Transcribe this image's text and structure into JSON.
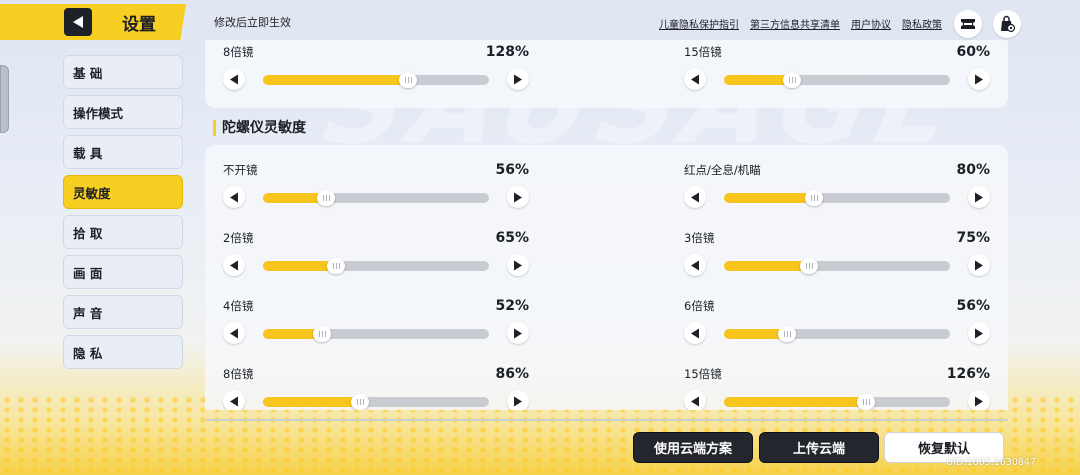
{
  "header": {
    "title": "设置",
    "note": "修改后立即生效"
  },
  "top_links": [
    "儿童隐私保护指引",
    "第三方信息共享清单",
    "用户协议",
    "隐私政策"
  ],
  "icons": {
    "back": "back-arrow-icon",
    "top_1": "ticket-icon",
    "top_2": "bag-settings-icon"
  },
  "sidebar": {
    "items": [
      {
        "label": "基 础",
        "active": false
      },
      {
        "label": "操作模式",
        "active": false
      },
      {
        "label": "载 具",
        "active": false
      },
      {
        "label": "灵敏度",
        "active": true
      },
      {
        "label": "拾 取",
        "active": false
      },
      {
        "label": "画 面",
        "active": false
      },
      {
        "label": "声 音",
        "active": false
      },
      {
        "label": "隐 私",
        "active": false
      }
    ]
  },
  "top_card": {
    "rows": [
      {
        "label": "8倍镜",
        "value": 128,
        "percent": "128%"
      },
      {
        "label": "15倍镜",
        "value": 60,
        "percent": "60%"
      }
    ]
  },
  "gyro": {
    "title": "陀螺仪灵敏度",
    "rows": [
      {
        "label": "不开镜",
        "value": 56,
        "percent": "56%"
      },
      {
        "label": "红点/全息/机瞄",
        "value": 80,
        "percent": "80%"
      },
      {
        "label": "2倍镜",
        "value": 65,
        "percent": "65%"
      },
      {
        "label": "3倍镜",
        "value": 75,
        "percent": "75%"
      },
      {
        "label": "4倍镜",
        "value": 52,
        "percent": "52%"
      },
      {
        "label": "6倍镜",
        "value": 56,
        "percent": "56%"
      },
      {
        "label": "8倍镜",
        "value": 86,
        "percent": "86%"
      },
      {
        "label": "15倍镜",
        "value": 126,
        "percent": "126%"
      }
    ]
  },
  "slider_max": 200,
  "buttons": {
    "cloud": "使用云端方案",
    "upload": "上传云端",
    "reset": "恢复默认"
  },
  "uid": "UID:1603.1630847",
  "colors": {
    "accent": "#f7cf22",
    "dark": "#23262d",
    "track": "#c8cbd2"
  }
}
